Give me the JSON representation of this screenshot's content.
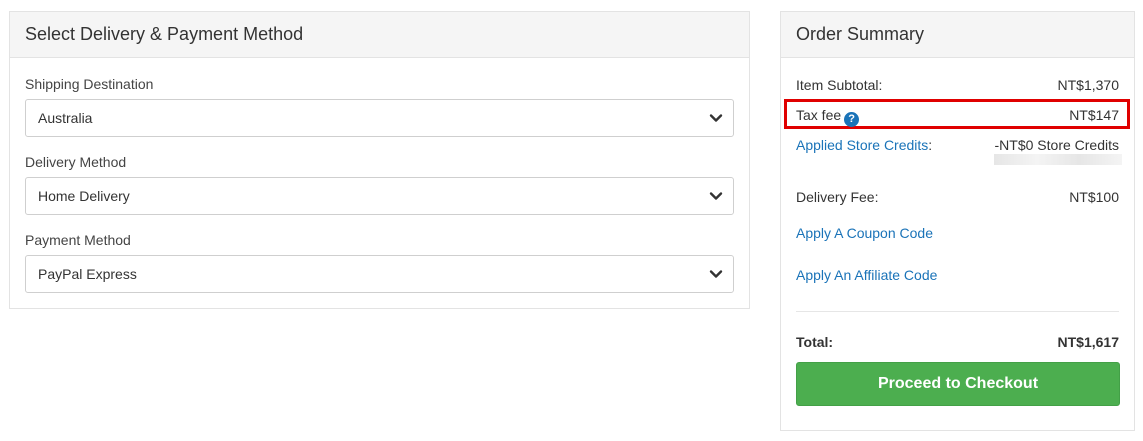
{
  "delivery_panel": {
    "title": "Select Delivery & Payment Method",
    "shipping": {
      "label": "Shipping Destination",
      "value": "Australia"
    },
    "delivery": {
      "label": "Delivery Method",
      "value": "Home Delivery"
    },
    "payment": {
      "label": "Payment Method",
      "value": "PayPal Express"
    }
  },
  "summary": {
    "title": "Order Summary",
    "subtotal": {
      "label": "Item Subtotal:",
      "value": "NT$1,370"
    },
    "tax": {
      "label": "Tax fee",
      "value": "NT$147",
      "help_icon": "?"
    },
    "credits": {
      "label": "Applied Store Credits",
      "label_suffix": ":",
      "value": "-NT$0 Store Credits"
    },
    "delivery_fee": {
      "label": "Delivery Fee:",
      "value": "NT$100"
    },
    "coupon_link": "Apply A Coupon Code",
    "affiliate_link": "Apply An Affiliate Code",
    "total": {
      "label": "Total:",
      "value": "NT$1,617"
    },
    "checkout_button": "Proceed to Checkout"
  },
  "colors": {
    "link": "#1a73b8",
    "checkout": "#4cae4f",
    "highlight": "#e00000"
  }
}
